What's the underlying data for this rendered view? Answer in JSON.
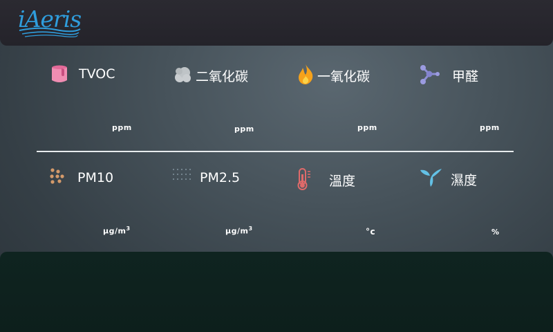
{
  "brand": {
    "name": "iAeris"
  },
  "top_sensors": [
    {
      "label": "TVOC",
      "unit": "ppm",
      "icon": "paint-bucket-icon",
      "color": "#e36a99"
    },
    {
      "label": "二氧化碳",
      "unit": "ppm",
      "icon": "smoke-cloud-icon",
      "color": "#c9cdd0"
    },
    {
      "label": "一氧化碳",
      "unit": "ppm",
      "icon": "flame-icon",
      "color": "#f6a21b"
    },
    {
      "label": "甲醛",
      "unit": "ppm",
      "icon": "molecule-icon",
      "color": "#8f8fd6"
    }
  ],
  "bottom_sensors": [
    {
      "label": "PM10",
      "unit": "μg/m",
      "unit_sup": "3",
      "icon": "coarse-particles-icon",
      "color": "#d49a6a"
    },
    {
      "label": "PM2.5",
      "unit": "μg/m",
      "unit_sup": "3",
      "icon": "fine-particles-icon",
      "color": "#7a8a94"
    },
    {
      "label": "溫度",
      "unit": "°c",
      "icon": "thermometer-icon",
      "color": "#e06a6a"
    },
    {
      "label": "濕度",
      "unit": "%",
      "icon": "water-drop-icon",
      "color": "#63c1e6"
    }
  ]
}
